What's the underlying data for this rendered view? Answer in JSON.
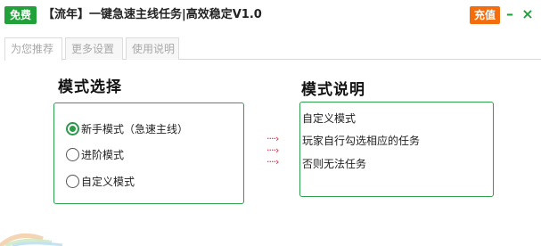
{
  "titlebar": {
    "free_badge": "免费",
    "title": "【流年】一键急速主线任务|高效稳定V1.0",
    "recharge_label": "充值",
    "minimize_icon": "minimize-icon",
    "close_icon": "close-icon",
    "accent_green": "#22a03a",
    "accent_orange": "#f36d0d"
  },
  "tabs": [
    {
      "label": "为您推荐",
      "active": true
    },
    {
      "label": "更多设置",
      "active": false
    },
    {
      "label": "使用说明",
      "active": false
    }
  ],
  "mode_section": {
    "title": "模式选择",
    "options": [
      {
        "label": "新手模式（急速主线）",
        "checked": true
      },
      {
        "label": "进阶模式",
        "checked": false
      },
      {
        "label": "自定义模式",
        "checked": false
      }
    ]
  },
  "arrows": {
    "icon": "arrow-right-icon",
    "color": "#e0243a"
  },
  "desc_section": {
    "title": "模式说明",
    "lines": [
      "自定义模式",
      "玩家自行勾选相应的任务",
      "否则无法任务"
    ]
  }
}
